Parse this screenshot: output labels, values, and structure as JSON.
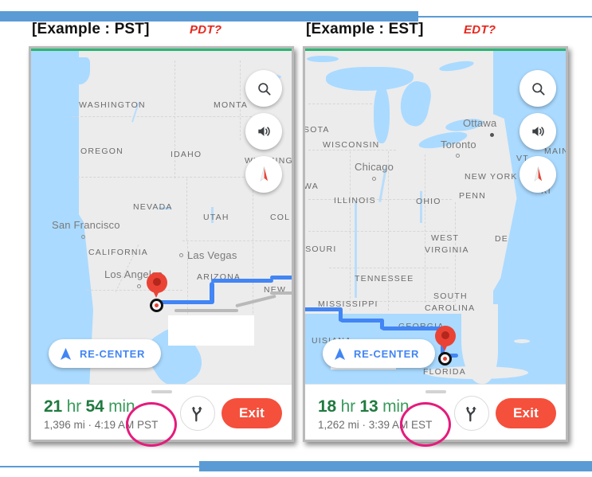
{
  "slide": {
    "accent_color": "#5b9bd5",
    "annotation_color": "#e51b7c",
    "note_color": "#e8261c"
  },
  "panels": [
    {
      "id": "pst",
      "heading": "[Example : PST]",
      "note": "PDT?",
      "map": {
        "controls": [
          {
            "name": "search-icon",
            "label": "search"
          },
          {
            "name": "sound-icon",
            "label": "sound on"
          },
          {
            "name": "compass-icon",
            "label": "compass north"
          }
        ],
        "recenter_label": "RE-CENTER",
        "state_labels": [
          "WASHINGTON",
          "MONTA",
          "OREGON",
          "IDAHO",
          "WYOMING",
          "NEVADA",
          "UTAH",
          "COL",
          "CALIFORNIA",
          "ARIZONA",
          "NEW"
        ],
        "city_labels": [
          "San Francisco",
          "Los Angeles",
          "Las Vegas"
        ]
      },
      "sheet": {
        "hours": "21",
        "hours_unit": "hr",
        "minutes": "54",
        "minutes_unit": "min",
        "details": "1,396 mi · 4:19 AM PST",
        "routes_icon": "alternate-routes-icon",
        "exit_label": "Exit"
      },
      "circled_text": "PST"
    },
    {
      "id": "est",
      "heading": "[Example : EST]",
      "note": "EDT?",
      "map": {
        "controls": [
          {
            "name": "search-icon",
            "label": "search"
          },
          {
            "name": "sound-icon",
            "label": "sound on"
          },
          {
            "name": "compass-icon",
            "label": "compass north"
          }
        ],
        "recenter_label": "RE-CENTER",
        "state_labels": [
          "SOTA",
          "WISCONSIN",
          "ILLINOIS",
          "WA",
          "OHIO",
          "PENN",
          "VT",
          "MAIN",
          "NEW YORK",
          "RI",
          "DE",
          "WEST",
          "VIRGINIA",
          "SSOURI",
          "TENNESSEE",
          "MISSISSIPPI",
          "SOUTH",
          "CAROLINA",
          "GEORGIA",
          "UISIANA",
          "FLORIDA"
        ],
        "city_labels": [
          "Ottawa",
          "Toronto",
          "Chicago"
        ]
      },
      "sheet": {
        "hours": "18",
        "hours_unit": "hr",
        "minutes": "13",
        "minutes_unit": "min",
        "details": "1,262 mi · 3:39 AM EST",
        "routes_icon": "alternate-routes-icon",
        "exit_label": "Exit"
      },
      "circled_text": "EST"
    }
  ]
}
